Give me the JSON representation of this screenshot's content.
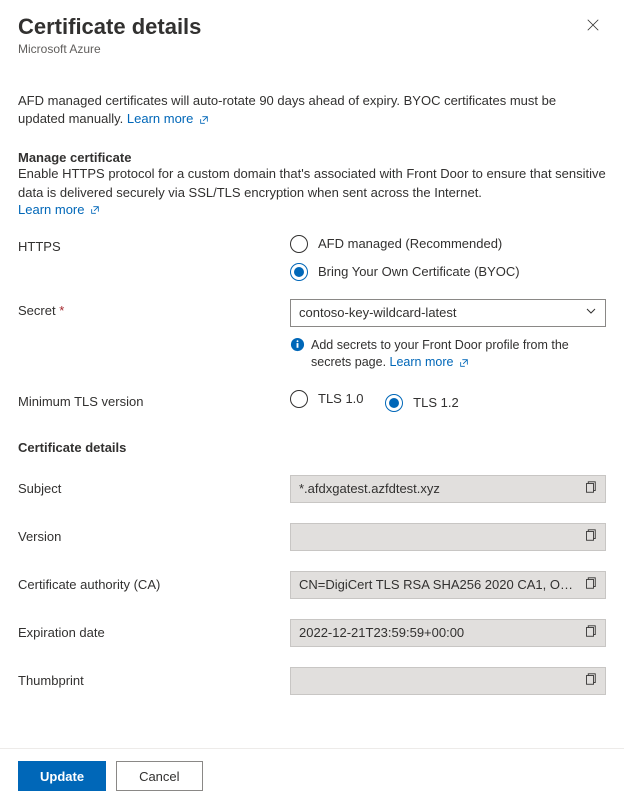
{
  "header": {
    "title": "Certificate details",
    "subtitle": "Microsoft Azure"
  },
  "intro": {
    "text_pre": "AFD managed certificates will auto-rotate 90 days ahead of expiry. BYOC certificates must be updated manually. ",
    "learn_more": "Learn more"
  },
  "manage": {
    "heading": "Manage certificate",
    "text": "Enable HTTPS protocol for a custom domain that's associated with Front Door to ensure that sensitive data is delivered securely via SSL/TLS encryption when sent across the Internet.",
    "learn_more": "Learn more"
  },
  "fields": {
    "https_label": "HTTPS",
    "https_opt_managed": "AFD managed (Recommended)",
    "https_opt_byoc": "Bring Your Own Certificate (BYOC)",
    "secret_label": "Secret",
    "secret_value": "contoso-key-wildcard-latest",
    "secret_hint_pre": "Add secrets to your Front Door profile from the secrets page. ",
    "secret_hint_link": "Learn more",
    "tls_label": "Minimum TLS version",
    "tls_opt_10": "TLS 1.0",
    "tls_opt_12": "TLS 1.2"
  },
  "cert": {
    "heading": "Certificate details",
    "subject_label": "Subject",
    "subject_value": "*.afdxgatest.azfdtest.xyz",
    "version_label": "Version",
    "version_value": "",
    "ca_label": "Certificate authority (CA)",
    "ca_value": "CN=DigiCert TLS RSA SHA256 2020 CA1, O…",
    "exp_label": "Expiration date",
    "exp_value": "2022-12-21T23:59:59+00:00",
    "thumb_label": "Thumbprint",
    "thumb_value": ""
  },
  "footer": {
    "update": "Update",
    "cancel": "Cancel"
  }
}
